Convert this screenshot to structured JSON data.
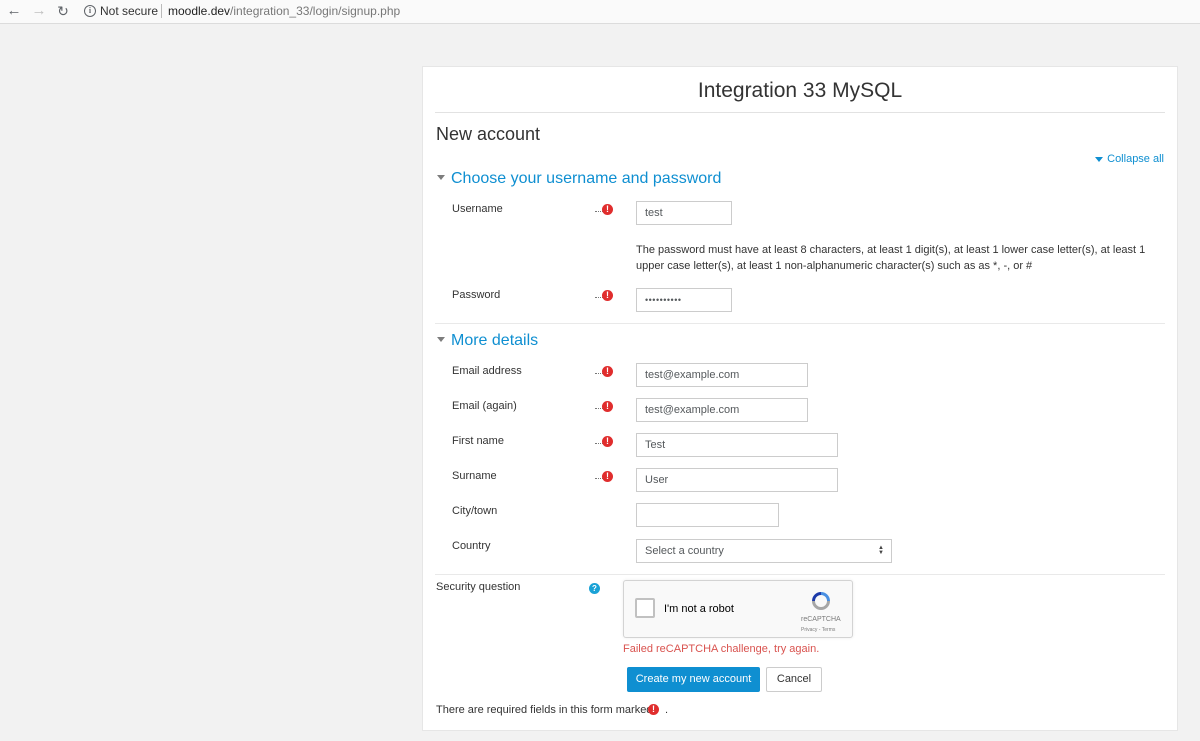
{
  "browser": {
    "back_glyph": "←",
    "forward_glyph": "→",
    "reload_glyph": "↻",
    "info_glyph": "i",
    "security_label": "Not secure",
    "url_host": "moodle.dev",
    "url_path": "/integration_33/login/signup.php"
  },
  "site_title": "Integration 33 MySQL",
  "page_heading": "New account",
  "collapse_all_label": "Collapse all",
  "sections": {
    "account": {
      "title": "Choose your username and password"
    },
    "details": {
      "title": "More details"
    }
  },
  "required_icon_glyph": "!",
  "help_icon_glyph": "?",
  "fields": {
    "username": {
      "label": "Username",
      "value": "test",
      "required": true
    },
    "password_help": "The password must have at least 8 characters, at least 1 digit(s), at least 1 lower case letter(s), at least 1 upper case letter(s), at least 1 non-alphanumeric character(s) such as as *, -, or #",
    "password": {
      "label": "Password",
      "value_mask": "••••••••••",
      "required": true
    },
    "email": {
      "label": "Email address",
      "value": "test@example.com",
      "required": true
    },
    "email_again": {
      "label": "Email (again)",
      "value": "test@example.com",
      "required": true
    },
    "firstname": {
      "label": "First name",
      "value": "Test",
      "required": true
    },
    "surname": {
      "label": "Surname",
      "value": "User",
      "required": true
    },
    "city": {
      "label": "City/town",
      "value": ""
    },
    "country": {
      "label": "Country",
      "selected": "Select a country"
    }
  },
  "security": {
    "label": "Security question",
    "checkbox_label": "I'm not a robot",
    "brand": "reCAPTCHA",
    "terms": "Privacy - Terms",
    "error": "Failed reCAPTCHA challenge, try again."
  },
  "buttons": {
    "submit": "Create my new account",
    "cancel": "Cancel"
  },
  "required_note": "There are required fields in this form marked",
  "required_note_end": ".",
  "colors": {
    "accent": "#0f8fd1",
    "required": "#e02d2d",
    "error": "#d9534f"
  }
}
